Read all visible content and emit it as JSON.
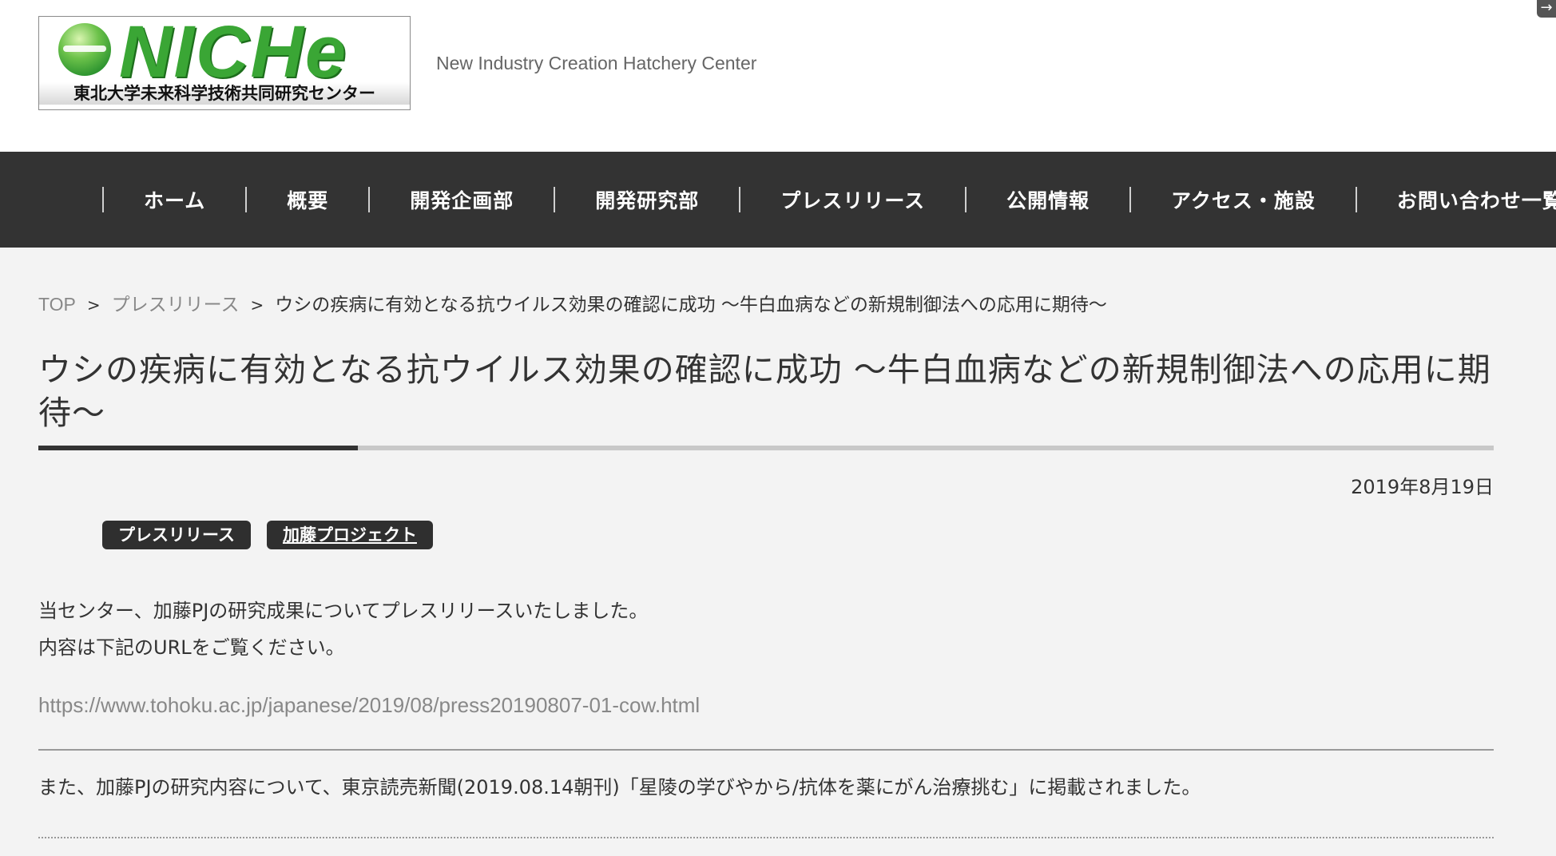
{
  "header": {
    "logo_word": "NICHe",
    "logo_jp": "東北大学未来科学技術共同研究センター",
    "tagline": "New Industry Creation Hatchery Center",
    "corner_icon": "arrow-right-icon"
  },
  "nav": {
    "items": [
      {
        "label": "ホーム"
      },
      {
        "label": "概要"
      },
      {
        "label": "開発企画部"
      },
      {
        "label": "開発研究部"
      },
      {
        "label": "プレスリリース"
      },
      {
        "label": "公開情報"
      },
      {
        "label": "アクセス・施設"
      },
      {
        "label": "お問い合わせ一覧"
      }
    ]
  },
  "breadcrumb": {
    "items": [
      "TOP",
      "プレスリリース"
    ],
    "separator": ">",
    "current": "ウシの疾病に有効となる抗ウイルス効果の確認に成功 〜牛白血病などの新規制御法への応用に期待〜"
  },
  "article": {
    "title": "ウシの疾病に有効となる抗ウイルス効果の確認に成功 〜牛白血病などの新規制御法への応用に期待〜",
    "date": "2019年8月19日",
    "tags": [
      "プレスリリース",
      "加藤プロジェクト"
    ],
    "body_line1": "当センター、加藤PJの研究成果についてプレスリリースいたしました。",
    "body_line2": "内容は下記のURLをご覧ください。",
    "url": "https://www.tohoku.ac.jp/japanese/2019/08/press20190807-01-cow.html",
    "note": "また、加藤PJの研究内容について、東京読売新聞(2019.08.14朝刊)「星陵の学びやから/抗体を薬にがん治療挑む」に掲載されました。"
  },
  "colors": {
    "nav_bg": "#333333",
    "page_bg": "#f3f3f3",
    "logo_green": "#3aa635",
    "tag_bg": "#2f2f2f"
  }
}
